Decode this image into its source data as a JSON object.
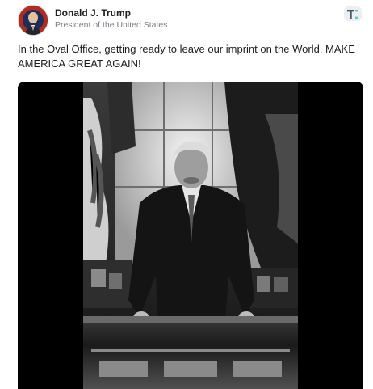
{
  "post": {
    "author_name": "Donald J. Trump",
    "author_title": "President of the United States",
    "text": "In the Oval Office, getting ready to leave our imprint on the World. MAKE AMERICA GREAT AGAIN!",
    "brand_icon": "truth-social-icon",
    "media": {
      "kind": "photo",
      "style": "black-and-white",
      "icon": "photo-image"
    }
  }
}
